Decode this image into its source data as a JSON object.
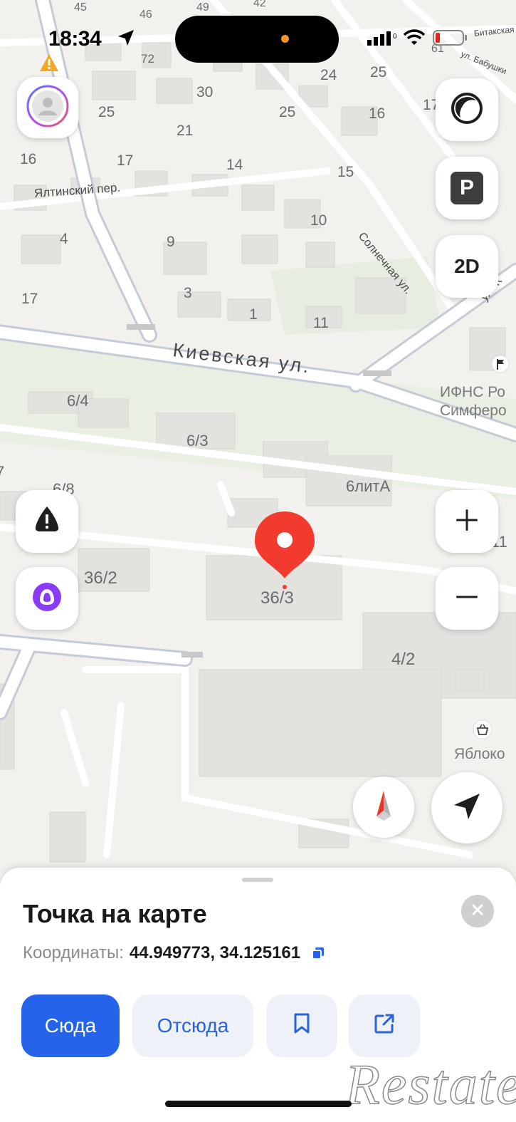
{
  "status_bar": {
    "time": "18:34",
    "icons": [
      "location-arrow-icon",
      "signal-icon",
      "wifi-icon",
      "battery-icon"
    ]
  },
  "map": {
    "streets": [
      {
        "id": "kievskaya",
        "label": "Киевская ул."
      },
      {
        "id": "yaltinsky",
        "label": "Ялтинский пер."
      },
      {
        "id": "solnechnaya",
        "label": "Солнечная ул."
      },
      {
        "id": "bitakskaya",
        "label": "Битакская"
      },
      {
        "id": "babushkina",
        "label": "ул. Бабушки"
      },
      {
        "id": "ul-right",
        "label": "ул. К"
      }
    ],
    "house_numbers": [
      "45",
      "46",
      "49",
      "42",
      "72",
      "30",
      "24",
      "25",
      "25",
      "16",
      "17",
      "25",
      "21",
      "16",
      "17",
      "14",
      "15",
      "4",
      "9",
      "10",
      "17",
      "3",
      "1",
      "11",
      "6/4",
      "6/3",
      "7",
      "6/8",
      "6литА",
      "36/2",
      "36/3",
      "4/2",
      "11",
      "61"
    ],
    "pois": [
      {
        "id": "ifns",
        "lines": [
          "ИФНС Ро",
          "Симферо"
        ],
        "icon": "flag-icon"
      },
      {
        "id": "yabloko",
        "lines": [
          "Яблоко"
        ],
        "icon": "basket-icon"
      }
    ],
    "pin": {
      "icon": "location-pin-icon",
      "color": "#f23a2f"
    }
  },
  "controls": {
    "profile": {
      "icon": "avatar-icon"
    },
    "warning": {
      "icon": "warning-triangle-icon"
    },
    "layers": {
      "icon": "layers-circle-icon"
    },
    "parking": {
      "label": "P"
    },
    "view_mode": {
      "label": "2D"
    },
    "report": {
      "icon": "report-incident-icon"
    },
    "alice": {
      "icon": "alice-assistant-icon"
    },
    "zoom_in": {
      "label": "+"
    },
    "zoom_out": {
      "label": "−"
    },
    "compass": {
      "icon": "compass-icon"
    },
    "locate": {
      "icon": "navigation-arrow-icon"
    }
  },
  "sheet": {
    "title": "Точка на карте",
    "coords_label": "Координаты:",
    "coords_value": "44.949773, 34.125161",
    "buttons": {
      "to_here": "Сюда",
      "from_here": "Отсюда"
    }
  },
  "watermark": {
    "text": "Restate"
  },
  "colors": {
    "accent": "#2563eb",
    "pin": "#f23a2f",
    "alice": "#8a3bf5",
    "map_bg": "#f2f1ee"
  }
}
